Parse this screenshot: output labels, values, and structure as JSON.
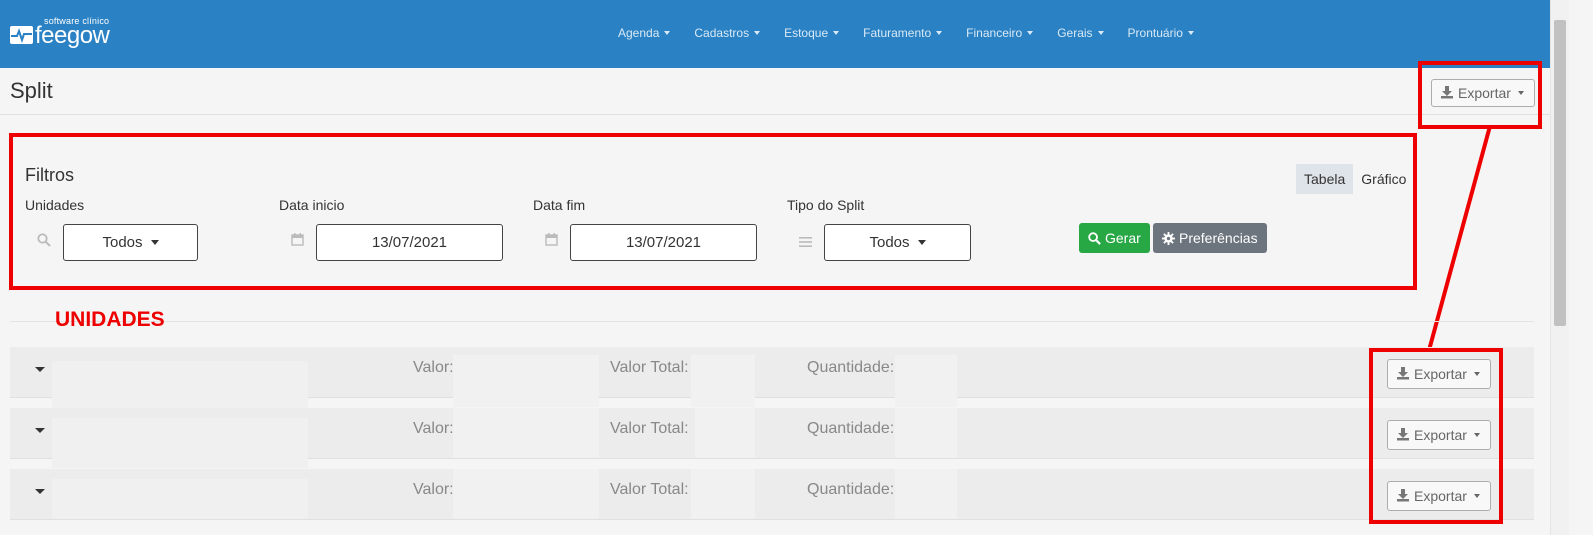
{
  "brand": {
    "tagline": "software clínico",
    "name": "feegow"
  },
  "nav": {
    "items": [
      "Agenda",
      "Cadastros",
      "Estoque",
      "Faturamento",
      "Financeiro",
      "Gerais",
      "Prontuário"
    ]
  },
  "page": {
    "title": "Split",
    "export_label": "Exportar"
  },
  "filters": {
    "title": "Filtros",
    "view_toggle": {
      "table": "Tabela",
      "chart": "Gráfico",
      "active": "Tabela"
    },
    "unidades": {
      "label": "Unidades",
      "value": "Todos"
    },
    "data_inicio": {
      "label": "Data inicio",
      "value": "13/07/2021"
    },
    "data_fim": {
      "label": "Data fim",
      "value": "13/07/2021"
    },
    "tipo_split": {
      "label": "Tipo do Split",
      "value": "Todos"
    },
    "gerar_label": "Gerar",
    "preferencias_label": "Preferências"
  },
  "section": {
    "title": "UNIDADES"
  },
  "rows": [
    {
      "valor_label": "Valor:",
      "valor_total_label": "Valor Total:",
      "quantidade_label": "Quantidade:",
      "export_label": "Exportar"
    },
    {
      "valor_label": "Valor:",
      "valor_total_label": "Valor Total:",
      "quantidade_label": "Quantidade:",
      "export_label": "Exportar"
    },
    {
      "valor_label": "Valor:",
      "valor_total_label": "Valor Total:",
      "quantidade_label": "Quantidade:",
      "export_label": "Exportar"
    }
  ],
  "colors": {
    "navbar": "#2a82c4",
    "accent_red": "#ee0000",
    "gerar_green": "#28a745",
    "preferencias_gray": "#6c757d"
  }
}
